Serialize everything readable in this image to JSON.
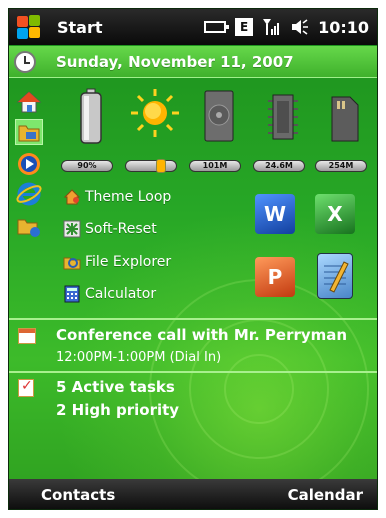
{
  "topbar": {
    "start_label": "Start",
    "edge_indicator": "E",
    "time": "10:10",
    "icons": [
      "windows-flag-icon",
      "battery-icon",
      "edge-data-icon",
      "signal-icon",
      "speaker-icon"
    ]
  },
  "date": {
    "text": "Sunday, November 11, 2007",
    "icon": "clock-icon"
  },
  "launcher": [
    {
      "icon": "home-icon"
    },
    {
      "icon": "folder-icon"
    },
    {
      "icon": "media-player-icon"
    },
    {
      "icon": "internet-explorer-icon"
    },
    {
      "icon": "folder-sync-icon"
    }
  ],
  "gauges": [
    {
      "icon": "battery-gauge-icon",
      "label": "90%"
    },
    {
      "icon": "brightness-icon",
      "label": ""
    },
    {
      "icon": "storage-icon",
      "label": "101M"
    },
    {
      "icon": "memory-chip-icon",
      "label": "24.6M"
    },
    {
      "icon": "sd-card-icon",
      "label": "254M"
    }
  ],
  "shortcuts": [
    {
      "label": "Theme Loop",
      "icon": "theme-loop-icon"
    },
    {
      "label": "Soft-Reset",
      "icon": "soft-reset-icon"
    },
    {
      "label": "File Explorer",
      "icon": "file-explorer-icon"
    },
    {
      "label": "Calculator",
      "icon": "calculator-icon"
    }
  ],
  "office_apps": [
    {
      "icon": "word-icon",
      "glyph": "W"
    },
    {
      "icon": "excel-icon",
      "glyph": "X"
    },
    {
      "icon": "powerpoint-icon",
      "glyph": "P"
    },
    {
      "icon": "notes-icon",
      "glyph": ""
    }
  ],
  "appointment": {
    "title": "Conference call with Mr. Perryman",
    "time": "12:00PM-1:00PM (Dial In)"
  },
  "tasks": {
    "active": "5 Active tasks",
    "priority": "2 High priority"
  },
  "softkeys": {
    "left": "Contacts",
    "right": "Calendar"
  },
  "colors": {
    "background": "#27a726",
    "date_bar": "#4fc23a",
    "bar_dark": "#0a0a0a",
    "separator": "#a8f08e"
  }
}
